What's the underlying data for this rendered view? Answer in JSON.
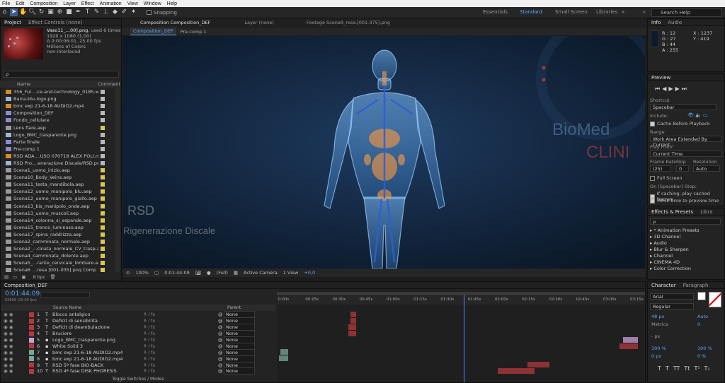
{
  "menu": [
    "File",
    "Edit",
    "Composition",
    "Layer",
    "Effect",
    "Animation",
    "View",
    "Window",
    "Help"
  ],
  "toolbar": {
    "snapping_label": "Snapping",
    "workspaces": [
      "Essentials",
      "Standard",
      "Small Screen",
      "Libraries"
    ],
    "active_workspace": "Standard",
    "search_placeholder": "Search Help"
  },
  "project": {
    "tabs": [
      "Project",
      "Effect Controls (none)"
    ],
    "selected_file": "Vaso11_...00].png",
    "used_times": ", used 6 times",
    "details": [
      "1920 x 1080 (1,00)",
      "Δ 0:00:06:01, 25,00 fps",
      "Millions of Colors",
      "non-interlaced"
    ],
    "search_placeholder": "ρ",
    "columns": [
      "Name",
      "Comment"
    ],
    "bpc": "8 bpc",
    "items": [
      {
        "name": "356_Ful....ce-and-technology_0185.wav",
        "type": "audio",
        "color": "#b8b8b8"
      },
      {
        "name": "Barra-blu-logo.png",
        "type": "image",
        "color": "#b8b8b8"
      },
      {
        "name": "bmc exp 21-6-18 AUDIO2.mp4",
        "type": "audio",
        "color": "#b8b8b8"
      },
      {
        "name": "Composition_DEF",
        "type": "comp",
        "color": "#b8b8b8"
      },
      {
        "name": "Fondo_cellulare",
        "type": "comp",
        "color": "#b8b8b8"
      },
      {
        "name": "Lens flare.aep",
        "type": "folder",
        "color": "#d6c94c"
      },
      {
        "name": "Logo_BMC_trasparente.png",
        "type": "image",
        "color": "#b8b8b8"
      },
      {
        "name": "Parte finale",
        "type": "comp",
        "color": "#b8b8b8"
      },
      {
        "name": "Pre-comp 1",
        "type": "comp",
        "color": "#b8b8b8"
      },
      {
        "name": "RSD ADA....USO 070718 ALEX POLI.mp3",
        "type": "audio",
        "color": "#b8b8b8"
      },
      {
        "name": "RSD Pro....enerazione Discale/RSD.psd",
        "type": "image",
        "color": "#b8b8b8"
      },
      {
        "name": "Scena1_uomo_inizio.aep",
        "type": "folder",
        "color": "#d6c94c"
      },
      {
        "name": "Scena10_Body_Veins.aep",
        "type": "folder",
        "color": "#d6c94c"
      },
      {
        "name": "Scena11_testa_mandibola.aep",
        "type": "folder",
        "color": "#d6c94c"
      },
      {
        "name": "Scena12_uomo_manipolo_blu.aep",
        "type": "folder",
        "color": "#d6c94c"
      },
      {
        "name": "Scena12_uomo_manipolo_giallo.aep",
        "type": "folder",
        "color": "#d6c94c"
      },
      {
        "name": "Scena13_bis_manipolo_onde.aep",
        "type": "folder",
        "color": "#d6c94c"
      },
      {
        "name": "Scena13_uomo_muscoli.aep",
        "type": "folder",
        "color": "#d6c94c"
      },
      {
        "name": "Scena14_colonna_si_espande.aep",
        "type": "folder",
        "color": "#d6c94c"
      },
      {
        "name": "Scena15_tronco_luminoso.aep",
        "type": "folder",
        "color": "#d6c94c"
      },
      {
        "name": "Scena17_spina_raddrizza.aep",
        "type": "folder",
        "color": "#d6c94c"
      },
      {
        "name": "Scena2_camminata_normale.aep",
        "type": "folder",
        "color": "#d6c94c"
      },
      {
        "name": "Scena2_...cinata_normale_CV_trasp.aep",
        "type": "folder",
        "color": "#d6c94c"
      },
      {
        "name": "Scena4_camminata_dolente.aep",
        "type": "folder",
        "color": "#d6c94c"
      },
      {
        "name": "Scena5_...rante_cervicale_lombare.aep",
        "type": "folder",
        "color": "#d6c94c"
      },
      {
        "name": "Scena6_...resa [001-035].png Comp 1",
        "type": "folder",
        "color": "#d6c94c"
      }
    ]
  },
  "viewer": {
    "tabs": [
      "Composition Composition_DEF",
      "Layer (none)",
      "Footage Scena9_resa.[001-375].png"
    ],
    "subtabs": [
      "Composition_DEF",
      "Pre-comp 1"
    ],
    "overlay_left_title": "RSD",
    "overlay_left_sub": "Rigenerazione Discale",
    "overlay_right_title": "BioMed",
    "overlay_right_sub": "CLINI",
    "zoom": "100%",
    "timecode": "0:01:44:09",
    "resolution": "(Full)",
    "camera": "Active Camera",
    "views": "1 View",
    "exposure": "+0,0"
  },
  "info": {
    "tabs": [
      "Info",
      "Audio"
    ],
    "r": "R : 12",
    "g": "G : 27",
    "b": "B : 44",
    "a": "A : 255",
    "x": "X : 1237",
    "y": "Y : 419",
    "swatch": "#0c1b2c"
  },
  "preview": {
    "title": "Preview",
    "shortcut_label": "Shortcut",
    "shortcut_value": "Spacebar",
    "include_label": "Include:",
    "cache_before": "Cache Before Playback",
    "range_label": "Range",
    "range_value": "Work Area Extended By Current...",
    "play_from_label": "Play From",
    "play_from_value": "Current Time",
    "frame_rate_label": "Frame Rate",
    "skip_label": "Skip",
    "resolution_label": "Resolution",
    "frame_rate_value": "(25)",
    "skip_value": "0",
    "resolution_value": "Auto",
    "full_screen": "Full Screen",
    "on_spacebar": "On (Spacebar) Stop:",
    "if_caching": "If caching, play cached frames",
    "move_time": "Move time to preview time"
  },
  "effects": {
    "tabs": [
      "Effects & Presets",
      "Libra"
    ],
    "search_placeholder": "ρ",
    "items": [
      "* Animation Presets",
      "3D Channel",
      "Audio",
      "Blur & Sharpen",
      "Channel",
      "CINEMA 4D",
      "Color Correction"
    ]
  },
  "character": {
    "tabs": [
      "Character",
      "Paragraph"
    ],
    "font": "Arial",
    "style": "Regular",
    "size": "48 px",
    "leading": "Auto",
    "kerning": "Metrics",
    "tracking": "0",
    "stroke": "- px",
    "vscale": "100 %",
    "hscale": "100 %",
    "baseline": "0 px",
    "tsume": "0 %",
    "styles": [
      "T",
      "T",
      "TT",
      "Tt",
      "T¹",
      "T₁"
    ]
  },
  "timeline": {
    "tab": "Composition_DEF",
    "timecode": "0:01:44:09",
    "frames": "02609 (25.00 fps)",
    "columns": {
      "source": "Source Name",
      "parent": "Parent"
    },
    "toggle_label": "Toggle Switches / Modes",
    "ruler": [
      "0:00s",
      "00:15s",
      "00:30s",
      "00:45s",
      "01:00s",
      "01:15s",
      "01:30s",
      "01:45s",
      "02:00s",
      "02:15s",
      "02:30s",
      "02:45s",
      "03:00s",
      "03:15s"
    ],
    "playhead_fraction": 0.508,
    "layers": [
      {
        "num": "1",
        "type": "T",
        "name": "Blocco antalgico",
        "parent": "None",
        "color": "#b3393e"
      },
      {
        "num": "2",
        "type": "T",
        "name": "Deficit di sensibilità",
        "parent": "None",
        "color": "#b3393e"
      },
      {
        "num": "3",
        "type": "T",
        "name": "Deficit di deambulazione",
        "parent": "None",
        "color": "#b3393e"
      },
      {
        "num": "4",
        "type": "T",
        "name": "Bruciore",
        "parent": "None",
        "color": "#b3393e"
      },
      {
        "num": "5",
        "type": "img",
        "name": "Logo_BMC_trasparente.png",
        "parent": "None",
        "color": "#c9a0dc"
      },
      {
        "num": "6",
        "type": "solid",
        "name": "White Solid 3",
        "parent": "None",
        "color": "#b3393e"
      },
      {
        "num": "7",
        "type": "img",
        "name": "bmc exp 21-6-18 AUDIO2.mp4",
        "parent": "None",
        "color": "#79a89a"
      },
      {
        "num": "8",
        "type": "img",
        "name": "bmc exp 21-6-18 AUDIO2.mp4",
        "parent": "None",
        "color": "#79a89a"
      },
      {
        "num": "9",
        "type": "T",
        "name": "RSD 5ª fase BIO-BACK",
        "parent": "None",
        "color": "#b3393e"
      },
      {
        "num": "10",
        "type": "T",
        "name": "RSD 4ª fase DISK PHORESIS",
        "parent": "None",
        "color": "#b3393e"
      }
    ]
  }
}
